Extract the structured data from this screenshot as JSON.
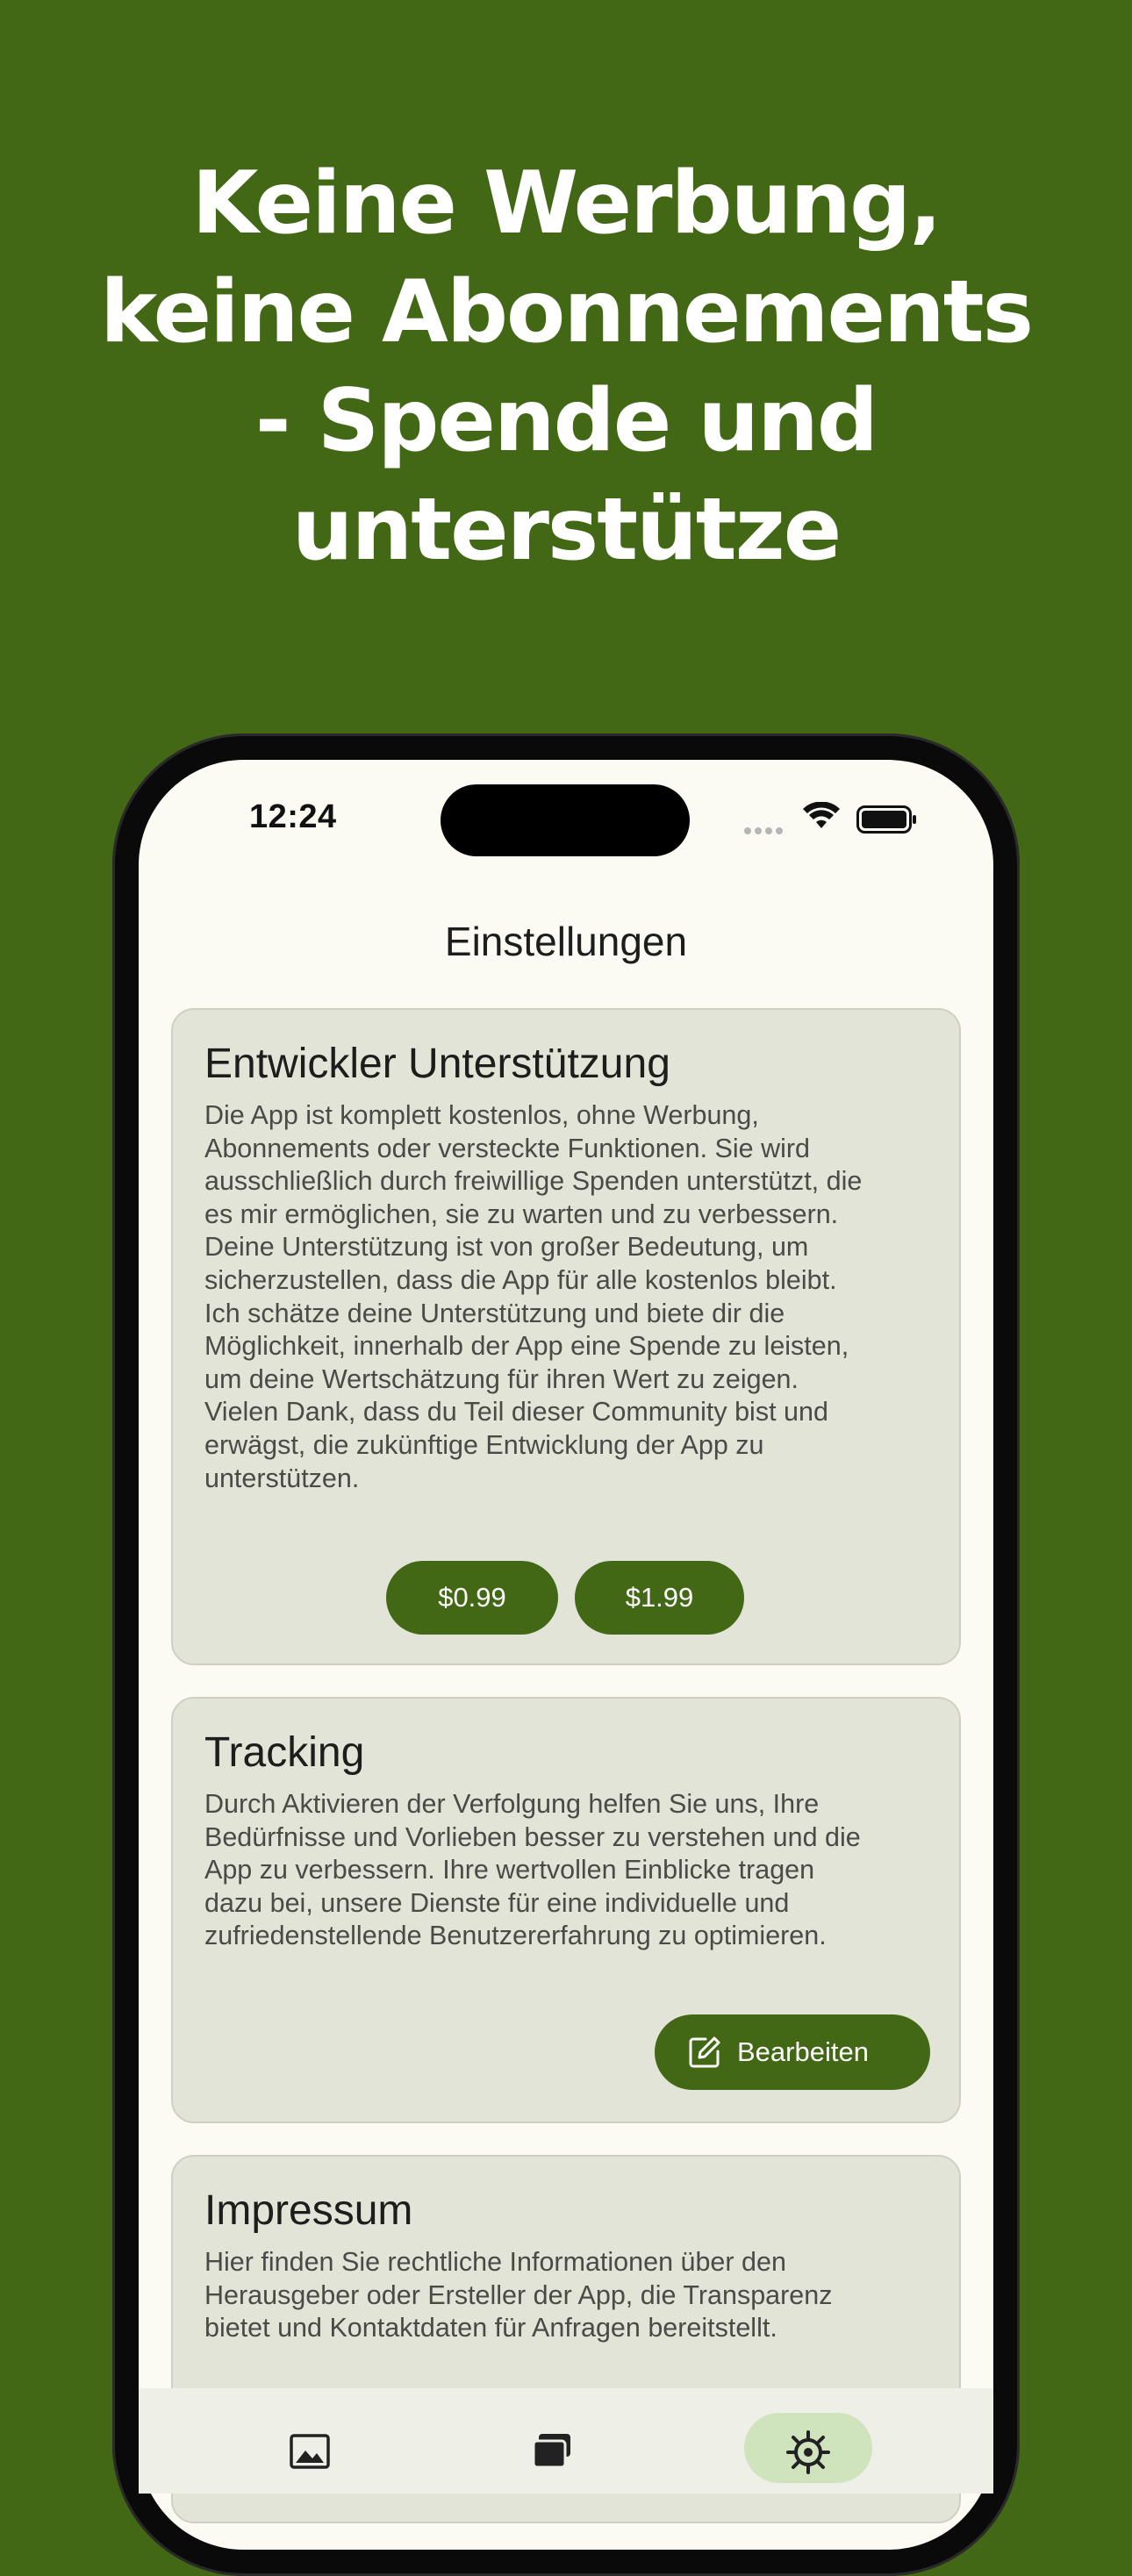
{
  "promo": {
    "headline_lines": [
      "Keine Werbung,",
      "keine Abonnements",
      "- Spende und",
      "unterstütze"
    ]
  },
  "status_bar": {
    "time": "12:24"
  },
  "nav": {
    "title": "Einstellungen"
  },
  "cards": {
    "support": {
      "title": "Entwickler Unterstützung",
      "body_lines": [
        "Die App ist komplett kostenlos, ohne Werbung,",
        "Abonnements oder versteckte Funktionen. Sie wird",
        "ausschließlich durch freiwillige Spenden unterstützt, die",
        "es mir ermöglichen, sie zu warten und zu verbessern.",
        "Deine Unterstützung ist von großer Bedeutung, um",
        "sicherzustellen, dass die App für alle kostenlos bleibt.",
        "Ich schätze deine Unterstützung und biete dir die",
        "Möglichkeit, innerhalb der App eine Spende zu leisten,",
        "um deine Wertschätzung für ihren Wert zu zeigen.",
        "Vielen Dank, dass du Teil dieser Community bist und",
        "erwägst, die zukünftige Entwicklung der App zu",
        "unterstützen."
      ],
      "buttons": [
        "$0.99",
        "$1.99"
      ]
    },
    "tracking": {
      "title": "Tracking",
      "body_lines": [
        "Durch Aktivieren der Verfolgung helfen Sie uns, Ihre",
        "Bedürfnisse und Vorlieben besser zu verstehen und die",
        "App zu verbessern. Ihre wertvollen Einblicke tragen",
        "dazu bei, unsere Dienste für eine individuelle und",
        "zufriedenstellende Benutzererfahrung zu optimieren."
      ],
      "edit_label": "Bearbeiten"
    },
    "imprint": {
      "title": "Impressum",
      "body_lines": [
        "Hier finden Sie rechtliche Informationen über den",
        "Herausgeber oder Ersteller der App, die Transparenz",
        "bietet und Kontaktdaten für Anfragen bereitstellt."
      ]
    }
  },
  "tab_bar": {
    "tabs": [
      {
        "icon": "image-icon",
        "active": false
      },
      {
        "icon": "cards-icon",
        "active": false
      },
      {
        "icon": "settings-gear-icon",
        "active": true
      }
    ]
  },
  "colors": {
    "brand_green": "#426816",
    "card_background": "#e3e4d8",
    "screen_background": "#fbfbf4",
    "active_tab_pill": "#cfe3bd"
  }
}
